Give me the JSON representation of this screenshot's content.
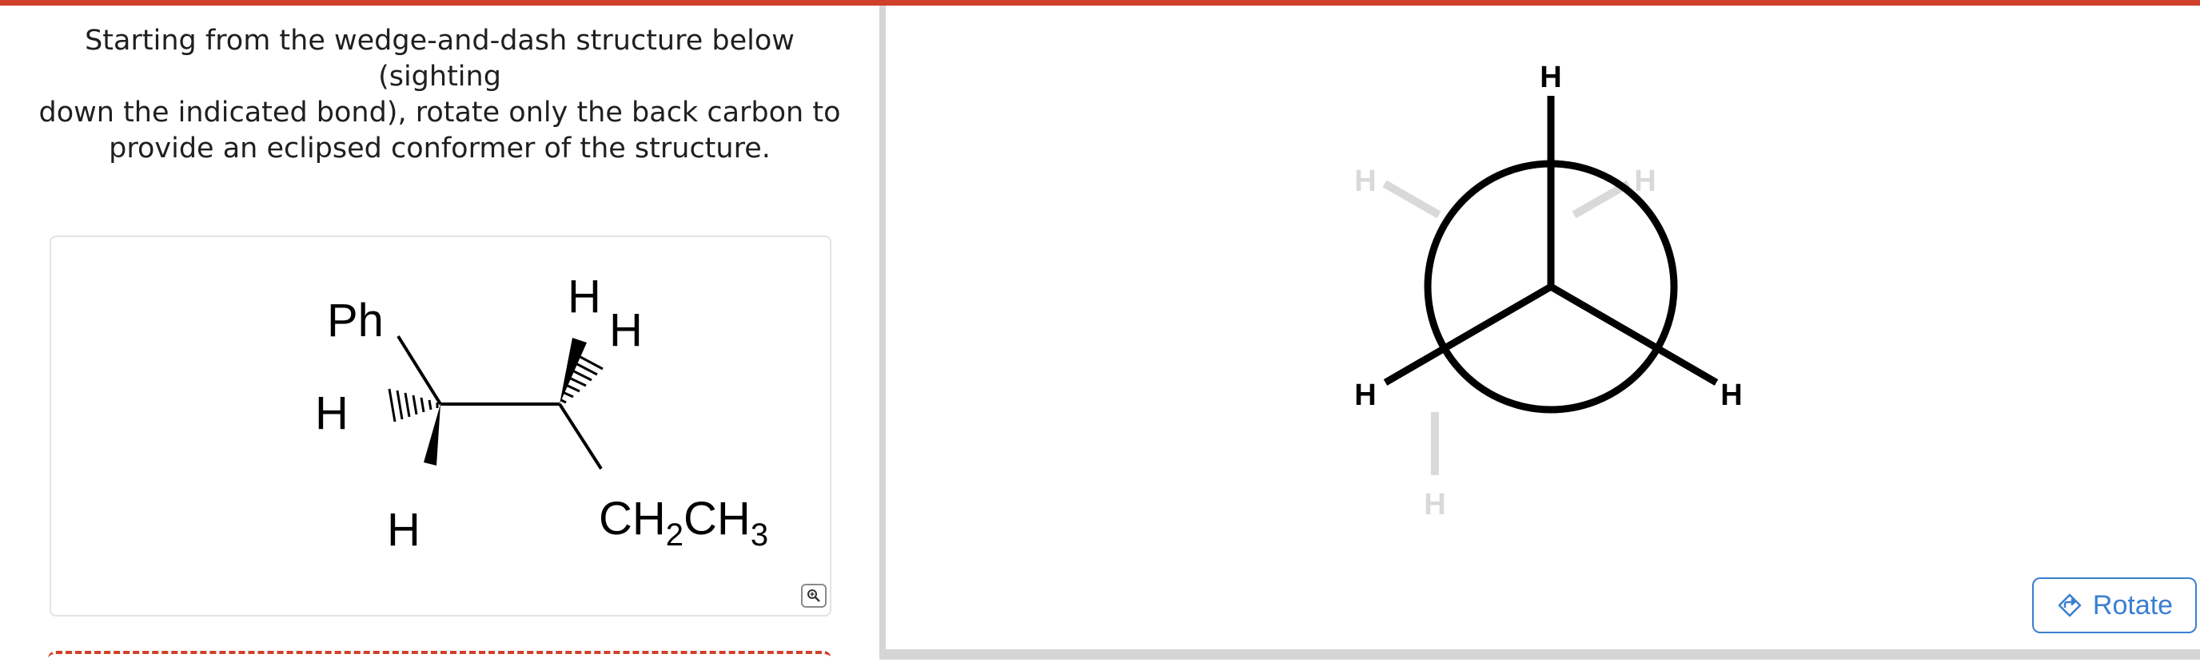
{
  "instructions": {
    "line1": "Starting from the wedge-and-dash structure below (sighting",
    "line2": "down the indicated bond), rotate only the back carbon to",
    "line3": "provide an eclipsed conformer of the structure."
  },
  "structure": {
    "ph_label": "Ph",
    "h_top": "H",
    "h_top_right": "H",
    "h_left": "H",
    "h_bottom": "H",
    "ethyl_ch": "CH",
    "ethyl_sub1": "2",
    "ethyl_ch2": "CH",
    "ethyl_sub2": "3"
  },
  "newman": {
    "front_top": "H",
    "front_left": "H",
    "front_right": "H",
    "back_top_left": "H",
    "back_top_right": "H",
    "back_bottom": "H",
    "back_color": "#d9d9d9"
  },
  "controls": {
    "rotate_label": "Rotate",
    "zoom_icon": "magnifier-icon",
    "rotate_icon": "rotate-icon"
  },
  "colors": {
    "accent_red": "#d0402b",
    "accent_blue": "#3a7fd1"
  }
}
